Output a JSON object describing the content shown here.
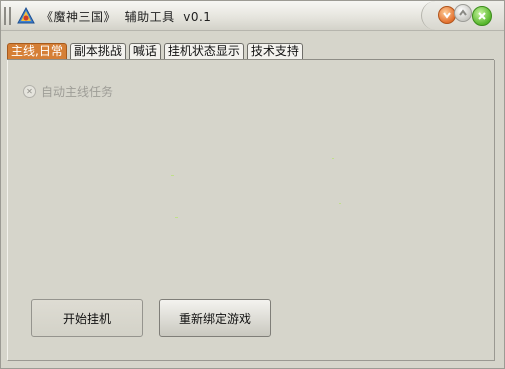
{
  "window": {
    "title": "《魔神三国》  辅助工具  v0.1"
  },
  "tabs": [
    {
      "label": "主线,日常",
      "active": true
    },
    {
      "label": "副本挑战",
      "active": false
    },
    {
      "label": "喊话",
      "active": false
    },
    {
      "label": "挂机状态显示",
      "active": false
    },
    {
      "label": "技术支持",
      "active": false
    }
  ],
  "main": {
    "auto_quest_label": "自动主线任务",
    "auto_quest_enabled": false
  },
  "buttons": {
    "start_label": "开始挂机",
    "rebind_label": "重新绑定游戏"
  },
  "colors": {
    "active_tab": "#d57f36",
    "minimize": "#e2702e",
    "close": "#57b62b",
    "background": "#d6d5cb"
  },
  "icons": {
    "app": "app-icon",
    "minimize": "minimize-icon",
    "maximize": "maximize-icon",
    "close": "close-icon"
  }
}
